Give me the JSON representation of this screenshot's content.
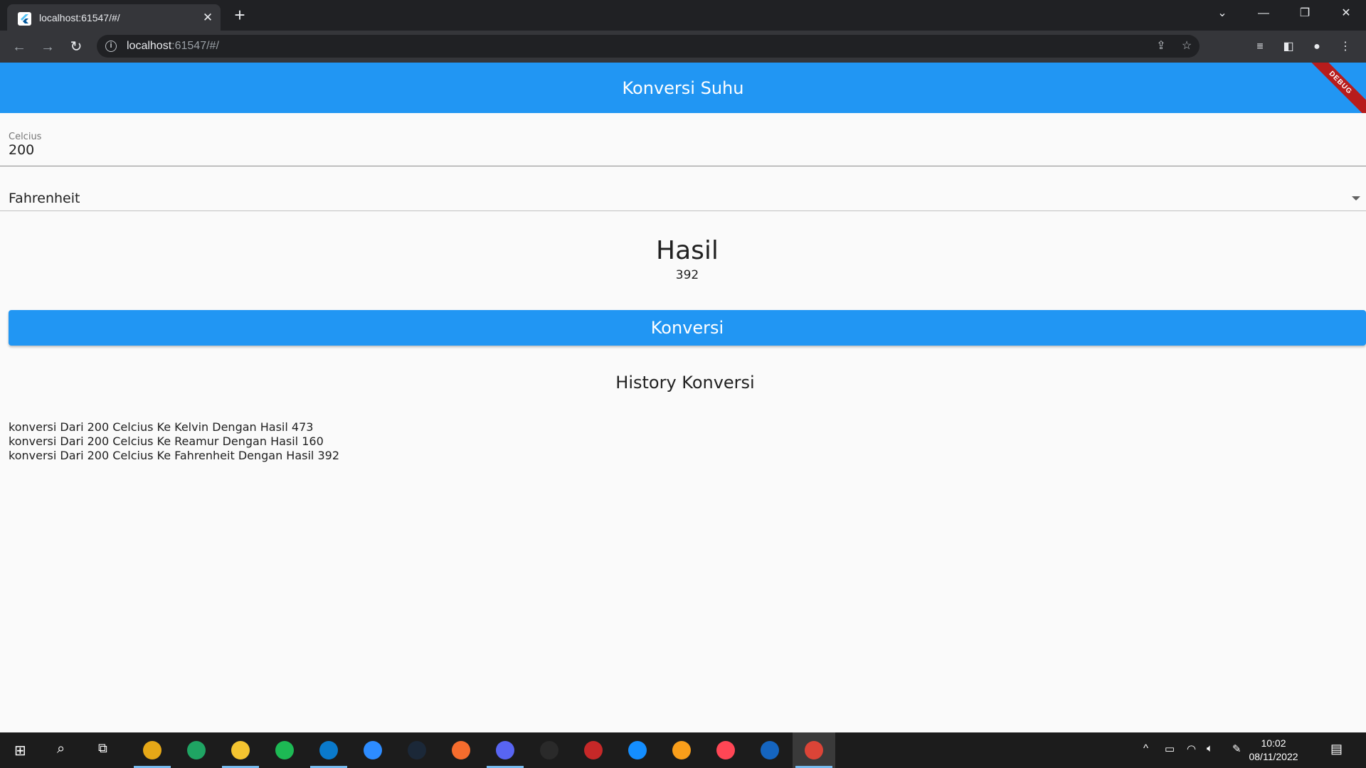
{
  "browser": {
    "tab_title": "localhost:61547/#/",
    "url_host": "localhost",
    "url_rest": ":61547/#/"
  },
  "app": {
    "title": "Konversi Suhu",
    "debug_banner": "DEBUG",
    "input": {
      "label": "Celcius",
      "value": "200"
    },
    "dropdown": {
      "selected": "Fahrenheit"
    },
    "result": {
      "title": "Hasil",
      "value": "392"
    },
    "convert_button": "Konversi",
    "history": {
      "title": "History Konversi",
      "items": [
        "konversi Dari 200 Celcius Ke Kelvin Dengan Hasil 473",
        "konversi Dari 200 Celcius Ke Reamur Dengan Hasil 160",
        "konversi Dari 200 Celcius Ke Fahrenheit Dengan Hasil 392"
      ]
    }
  },
  "taskbar": {
    "time": "10:02",
    "date": "08/11/2022",
    "apps": [
      {
        "name": "chrome-profile",
        "color": "#e6a817"
      },
      {
        "name": "edge",
        "color": "#1fa463"
      },
      {
        "name": "file-explorer",
        "color": "#f4c430"
      },
      {
        "name": "spotify",
        "color": "#1db954"
      },
      {
        "name": "vscode",
        "color": "#0a7acc"
      },
      {
        "name": "zoom",
        "color": "#2d8cff"
      },
      {
        "name": "steam",
        "color": "#1b2838"
      },
      {
        "name": "origin",
        "color": "#f56c2d"
      },
      {
        "name": "discord",
        "color": "#5865f2"
      },
      {
        "name": "epic-games",
        "color": "#2a2a2a"
      },
      {
        "name": "game-app",
        "color": "#c62828"
      },
      {
        "name": "battle-net",
        "color": "#148eff"
      },
      {
        "name": "overwatch",
        "color": "#f99e1a"
      },
      {
        "name": "valorant",
        "color": "#ff4655"
      },
      {
        "name": "word-app",
        "color": "#1565c0"
      },
      {
        "name": "chrome",
        "color": "#db4437"
      }
    ]
  },
  "colors": {
    "primary": "#2196f3",
    "debug": "#b71c1c"
  }
}
